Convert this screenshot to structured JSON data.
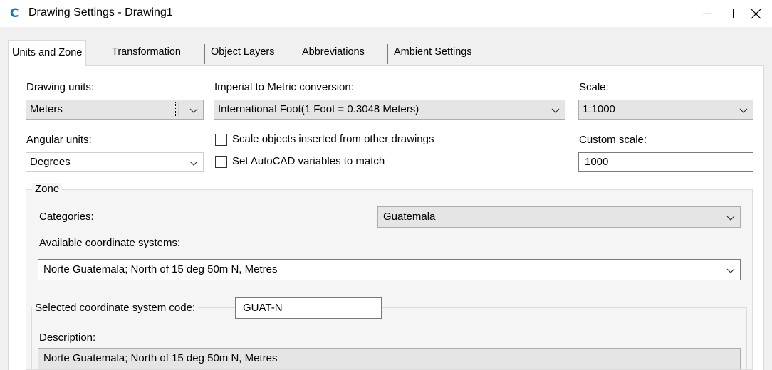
{
  "window": {
    "title": "Drawing Settings - Drawing1",
    "app_icon_glyph": "C",
    "controls": [
      "minimize-icon",
      "maximize-icon",
      "close-icon"
    ]
  },
  "tabs": [
    {
      "label": "Units and Zone",
      "active": true
    },
    {
      "label": "Transformation",
      "active": false
    },
    {
      "label": "Object Layers",
      "active": false
    },
    {
      "label": "Abbreviations",
      "active": false
    },
    {
      "label": "Ambient Settings",
      "active": false
    }
  ],
  "units": {
    "drawing_units_label": "Drawing units:",
    "drawing_units_value": "Meters",
    "conversion_label": "Imperial to Metric conversion:",
    "conversion_value": "International Foot(1 Foot = 0.3048 Meters)",
    "scale_label": "Scale:",
    "scale_value": "1:1000",
    "angular_label": "Angular units:",
    "angular_value": "Degrees",
    "scale_objects_label": "Scale objects inserted from other drawings",
    "scale_objects_checked": false,
    "set_autocad_label": "Set AutoCAD variables to match",
    "set_autocad_checked": false,
    "custom_scale_label": "Custom scale:",
    "custom_scale_value": "1000"
  },
  "zone": {
    "group_label": "Zone",
    "categories_label": "Categories:",
    "categories_value": "Guatemala",
    "available_label": "Available coordinate systems:",
    "available_value": "Norte Guatemala; North of 15 deg 50m N, Metres",
    "selected_code_label": "Selected coordinate system code:",
    "selected_code_value": "GUAT-N",
    "description_label": "Description:",
    "description_value": "Norte Guatemala; North of 15 deg 50m N, Metres"
  },
  "colors": {
    "app_icon": "#1e73be",
    "dialog_bg": "#f0f0f0",
    "combo_gray": "#e5e5e5"
  }
}
